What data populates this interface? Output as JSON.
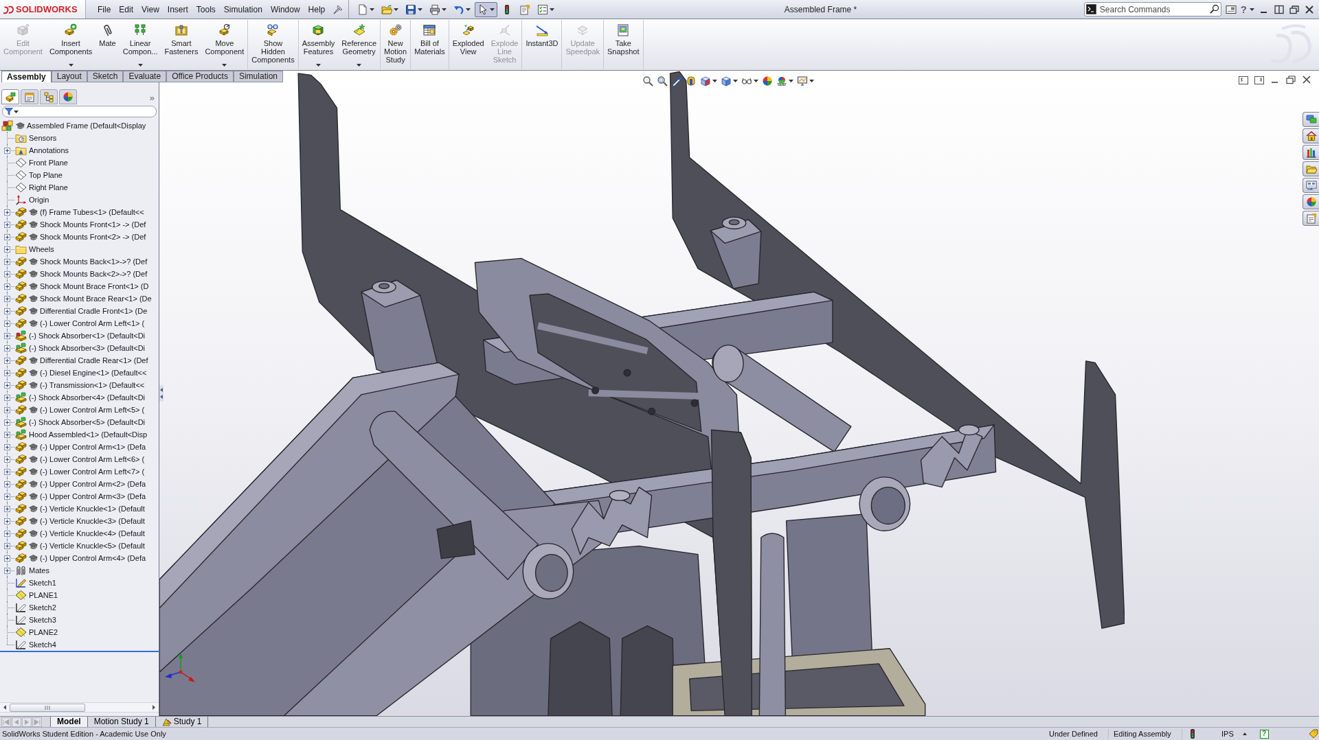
{
  "app": {
    "logo_text": "SOLIDWORKS"
  },
  "menu": [
    {
      "label": "File"
    },
    {
      "label": "Edit"
    },
    {
      "label": "View"
    },
    {
      "label": "Insert"
    },
    {
      "label": "Tools"
    },
    {
      "label": "Simulation"
    },
    {
      "label": "Window"
    },
    {
      "label": "Help"
    }
  ],
  "quick_access": [
    {
      "dropdown": true,
      "selected": false
    },
    {
      "dropdown": true,
      "selected": false
    },
    {
      "dropdown": true,
      "selected": false
    },
    {
      "dropdown": true,
      "selected": false
    },
    {
      "dropdown": true,
      "selected": false
    },
    {
      "dropdown": true,
      "selected": true
    },
    {
      "dropdown": false,
      "selected": false
    },
    {
      "dropdown": false,
      "selected": false
    },
    {
      "dropdown": true,
      "selected": false
    }
  ],
  "window": {
    "title": "Assembled Frame *",
    "help": "?"
  },
  "search": {
    "placeholder": "Search Commands"
  },
  "command_manager": {
    "groups": [
      [
        {
          "lines": [
            "Edit",
            "Component"
          ],
          "disabled": true,
          "dropdown": false
        },
        {
          "lines": [
            "Insert",
            "Components"
          ],
          "disabled": false,
          "dropdown": true
        },
        {
          "lines": [
            "Mate"
          ],
          "disabled": false,
          "dropdown": false
        },
        {
          "lines": [
            "Linear",
            "Compon..."
          ],
          "disabled": false,
          "dropdown": true
        },
        {
          "lines": [
            "Smart",
            "Fasteners"
          ],
          "disabled": false,
          "dropdown": false
        },
        {
          "lines": [
            "Move",
            "Component"
          ],
          "disabled": false,
          "dropdown": true
        }
      ],
      [
        {
          "lines": [
            "Show",
            "Hidden",
            "Components"
          ],
          "disabled": false,
          "dropdown": false
        }
      ],
      [
        {
          "lines": [
            "Assembly",
            "Features"
          ],
          "disabled": false,
          "dropdown": true
        },
        {
          "lines": [
            "Reference",
            "Geometry"
          ],
          "disabled": false,
          "dropdown": true
        }
      ],
      [
        {
          "lines": [
            "New",
            "Motion",
            "Study"
          ],
          "disabled": false,
          "dropdown": false
        }
      ],
      [
        {
          "lines": [
            "Bill of",
            "Materials"
          ],
          "disabled": false,
          "dropdown": false
        }
      ],
      [
        {
          "lines": [
            "Exploded",
            "View"
          ],
          "disabled": false,
          "dropdown": false
        },
        {
          "lines": [
            "Explode",
            "Line",
            "Sketch"
          ],
          "disabled": true,
          "dropdown": false
        }
      ],
      [
        {
          "lines": [
            "Instant3D"
          ],
          "disabled": false,
          "dropdown": false
        }
      ],
      [
        {
          "lines": [
            "Update",
            "Speedpak"
          ],
          "disabled": true,
          "dropdown": false
        }
      ],
      [
        {
          "lines": [
            "Take",
            "Snapshot"
          ],
          "disabled": false,
          "dropdown": false
        }
      ]
    ]
  },
  "tabs": [
    {
      "label": "Assembly",
      "selected": true
    },
    {
      "label": "Layout",
      "selected": false
    },
    {
      "label": "Sketch",
      "selected": false
    },
    {
      "label": "Evaluate",
      "selected": false
    },
    {
      "label": "Office Products",
      "selected": false
    },
    {
      "label": "Simulation",
      "selected": false
    }
  ],
  "feature_manager": {
    "panel_tabs": [
      {
        "selected": true
      },
      {
        "selected": false
      },
      {
        "selected": false
      },
      {
        "selected": false
      }
    ],
    "expand": "»",
    "tree": {
      "label": "Assembled Frame (Default<Display",
      "kind": "assembly",
      "student": true,
      "children": [
        {
          "label": "Sensors",
          "kind": "sensors",
          "collapsed": false
        },
        {
          "label": "Annotations",
          "kind": "annotations",
          "collapsed": true
        },
        {
          "label": "Front Plane",
          "kind": "plane",
          "collapsed": false,
          "shown": false
        },
        {
          "label": "Top Plane",
          "kind": "plane",
          "collapsed": false,
          "shown": false
        },
        {
          "label": "Right Plane",
          "kind": "plane",
          "collapsed": false,
          "shown": false
        },
        {
          "label": "Origin",
          "kind": "origin",
          "collapsed": false
        },
        {
          "label": "(f) Frame Tubes<1> (Default<<",
          "kind": "part",
          "collapsed": true,
          "student": true
        },
        {
          "label": "Shock Mounts Front<1> -> (Def",
          "kind": "part",
          "collapsed": true,
          "student": true
        },
        {
          "label": "Shock Mounts Front<2> -> (Def",
          "kind": "part",
          "collapsed": true,
          "student": true
        },
        {
          "label": "Wheels",
          "kind": "folder",
          "collapsed": true
        },
        {
          "label": "Shock Mounts Back<1>->? (Def",
          "kind": "part",
          "collapsed": true,
          "student": true
        },
        {
          "label": "Shock Mounts Back<2>->? (Def",
          "kind": "part",
          "collapsed": true,
          "student": true
        },
        {
          "label": "Shock Mount Brace Front<1> (D",
          "kind": "part",
          "collapsed": true,
          "student": true
        },
        {
          "label": "Shock Mount Brace Rear<1> (De",
          "kind": "part",
          "collapsed": true,
          "student": true
        },
        {
          "label": "Differential Cradle Front<1> (De",
          "kind": "part",
          "collapsed": true,
          "student": true
        },
        {
          "label": "(-) Lower Control Arm Left<1> (",
          "kind": "part",
          "collapsed": true,
          "student": true
        },
        {
          "label": "(-) Shock Absorber<1> (Default<Di",
          "kind": "subassembly",
          "collapsed": true,
          "student": false,
          "warning": true
        },
        {
          "label": "(-) Shock Absorber<3> (Default<Di",
          "kind": "subassembly",
          "collapsed": true,
          "student": false,
          "warning": false
        },
        {
          "label": "Differential Cradle Rear<1> (Def",
          "kind": "part",
          "collapsed": true,
          "student": true
        },
        {
          "label": "(-) Diesel Engine<1> (Default<<",
          "kind": "part",
          "collapsed": true,
          "student": true
        },
        {
          "label": "(-) Transmission<1> (Default<<",
          "kind": "part",
          "collapsed": true,
          "student": true
        },
        {
          "label": "(-) Shock Absorber<4> (Default<Di",
          "kind": "subassembly",
          "collapsed": true,
          "student": false,
          "warning": false
        },
        {
          "label": "(-) Lower Control Arm Left<5> (",
          "kind": "part",
          "collapsed": true,
          "student": true
        },
        {
          "label": "(-) Shock Absorber<5> (Default<Di",
          "kind": "subassembly",
          "collapsed": true,
          "student": false,
          "warning": false
        },
        {
          "label": "Hood Assembled<1> (Default<Disp",
          "kind": "subassembly",
          "collapsed": true,
          "student": false,
          "warning": false
        },
        {
          "label": "(-) Upper Control Arm<1> (Defa",
          "kind": "part",
          "collapsed": true,
          "student": true
        },
        {
          "label": "(-) Lower Control Arm Left<6> (",
          "kind": "part",
          "collapsed": true,
          "student": true
        },
        {
          "label": "(-) Lower Control Arm Left<7> (",
          "kind": "part",
          "collapsed": true,
          "student": true
        },
        {
          "label": "(-) Upper Control Arm<2> (Defa",
          "kind": "part",
          "collapsed": true,
          "student": true
        },
        {
          "label": "(-) Upper Control Arm<3> (Defa",
          "kind": "part",
          "collapsed": true,
          "student": true
        },
        {
          "label": "(-) Verticle Knuckle<1> (Default",
          "kind": "part",
          "collapsed": true,
          "student": true
        },
        {
          "label": "(-) Verticle Knuckle<3> (Default",
          "kind": "part",
          "collapsed": true,
          "student": true
        },
        {
          "label": "(-) Verticle Knuckle<4> (Default",
          "kind": "part",
          "collapsed": true,
          "student": true
        },
        {
          "label": "(-) Verticle Knuckle<5> (Default",
          "kind": "part",
          "collapsed": true,
          "student": true
        },
        {
          "label": "(-) Upper Control Arm<4> (Defa",
          "kind": "part",
          "collapsed": true,
          "student": true
        },
        {
          "label": "Mates",
          "kind": "mates",
          "collapsed": true
        },
        {
          "label": "Sketch1",
          "kind": "sketch",
          "collapsed": false,
          "shown": true
        },
        {
          "label": "PLANE1",
          "kind": "plane",
          "collapsed": false,
          "shown": true
        },
        {
          "label": "Sketch2",
          "kind": "sketch",
          "collapsed": false,
          "shown": false
        },
        {
          "label": "Sketch3",
          "kind": "sketch",
          "collapsed": false,
          "shown": false
        },
        {
          "label": "PLANE2",
          "kind": "plane",
          "collapsed": false,
          "shown": true
        },
        {
          "label": "Sketch4",
          "kind": "sketch",
          "collapsed": false,
          "shown": false
        }
      ]
    }
  },
  "view_toolbar": [
    {
      "dropdown": false
    },
    {
      "dropdown": false
    },
    {
      "dropdown": false
    },
    {
      "dropdown": false
    },
    {
      "dropdown": true
    },
    {
      "dropdown": true
    },
    {
      "dropdown": true
    },
    {
      "dropdown": false
    },
    {
      "dropdown": true
    },
    {
      "dropdown": true
    }
  ],
  "bottom_tabs": [
    {
      "label": "Model",
      "selected": true,
      "kind": "model"
    },
    {
      "label": "Motion Study 1",
      "selected": false,
      "kind": "motion"
    },
    {
      "label": "Study 1",
      "selected": false,
      "kind": "simulation"
    }
  ],
  "status_bar": {
    "edition": "SolidWorks Student Edition - Academic Use Only",
    "definition": "Under Defined",
    "mode": "Editing Assembly",
    "units": "IPS",
    "help": "?"
  }
}
